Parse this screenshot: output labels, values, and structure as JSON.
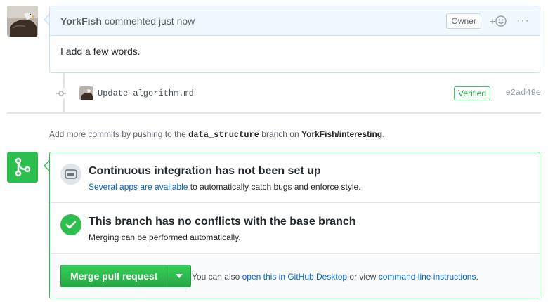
{
  "comment": {
    "author": "YorkFish",
    "meta": "commented just now",
    "owner_badge": "Owner",
    "react_label": "+",
    "more_label": "···",
    "body": "I add a few words."
  },
  "commit": {
    "message": "Update algorithm.md",
    "verified": "Verified",
    "sha": "e2ad49e"
  },
  "push_hint": {
    "prefix": "Add more commits by pushing to the",
    "branch": "data_structure",
    "middle": "branch on",
    "repo": "YorkFish/interesting",
    "suffix": "."
  },
  "ci": {
    "title": "Continuous integration has not been set up",
    "link": "Several apps are available",
    "rest": "to automatically catch bugs and enforce style."
  },
  "conflicts": {
    "title": "This branch has no conflicts with the base branch",
    "subtitle": "Merging can be performed automatically."
  },
  "merge": {
    "button": "Merge pull request",
    "hint_prefix": "You can also",
    "desktop_link": "open this in GitHub Desktop",
    "hint_middle": "or view",
    "cli_link": "command line instructions",
    "hint_suffix": "."
  },
  "colors": {
    "green": "#2cbe4e",
    "link": "#0366d6",
    "header_bg": "#f1f8ff"
  },
  "icons": [
    "avatar",
    "smiley-icon",
    "kebab-icon",
    "commit-icon",
    "git-merge-icon",
    "ci-icon",
    "check-icon",
    "caret-down-icon"
  ]
}
